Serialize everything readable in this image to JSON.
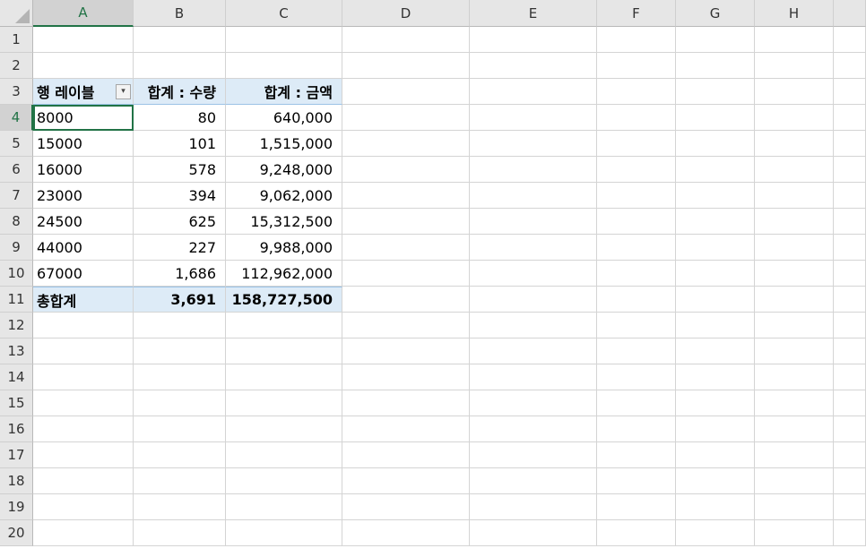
{
  "columns": [
    "A",
    "B",
    "C",
    "D",
    "E",
    "F",
    "G",
    "H",
    ""
  ],
  "rows": [
    "1",
    "2",
    "3",
    "4",
    "5",
    "6",
    "7",
    "8",
    "9",
    "10",
    "11",
    "12",
    "13",
    "14",
    "15",
    "16",
    "17",
    "18",
    "19",
    "20"
  ],
  "pivot": {
    "row_label": "행 레이블",
    "sum_qty_label": "합계 : 수량",
    "sum_amount_label": "합계 : 금액",
    "filter_icon": "filter-dropdown-icon",
    "records": [
      {
        "price": "8000",
        "qty": "80",
        "amount": "640,000"
      },
      {
        "price": "15000",
        "qty": "101",
        "amount": "1,515,000"
      },
      {
        "price": "16000",
        "qty": "578",
        "amount": "9,248,000"
      },
      {
        "price": "23000",
        "qty": "394",
        "amount": "9,062,000"
      },
      {
        "price": "24500",
        "qty": "625",
        "amount": "15,312,500"
      },
      {
        "price": "44000",
        "qty": "227",
        "amount": "9,988,000"
      },
      {
        "price": "67000",
        "qty": "1,686",
        "amount": "112,962,000"
      }
    ],
    "total_label": "총합계",
    "total_qty": "3,691",
    "total_amount": "158,727,500"
  },
  "selection": {
    "active_cell": "A4",
    "active_column": "A",
    "active_row": "4"
  },
  "colors": {
    "header_fill": "#ddebf7",
    "accent": "#217346",
    "gridline": "#d4d4d4"
  }
}
